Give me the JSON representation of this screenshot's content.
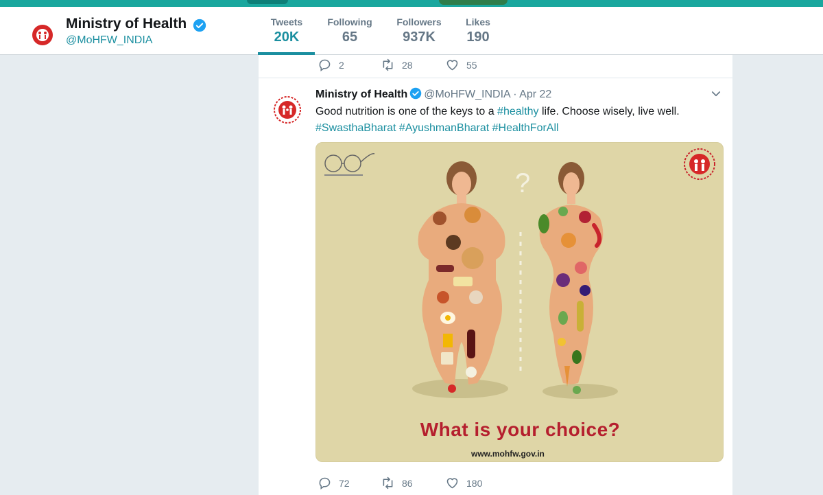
{
  "profile": {
    "name": "Ministry of Health",
    "handle": "@MoHFW_INDIA"
  },
  "stats": [
    {
      "label": "Tweets",
      "value": "20K",
      "active": true
    },
    {
      "label": "Following",
      "value": "65",
      "active": false
    },
    {
      "label": "Followers",
      "value": "937K",
      "active": false
    },
    {
      "label": "Likes",
      "value": "190",
      "active": false
    }
  ],
  "prev_tweet_actions": {
    "replies": "2",
    "retweets": "28",
    "likes": "55"
  },
  "tweet": {
    "name": "Ministry of Health",
    "handle_date": "@MoHFW_INDIA · Apr 22",
    "text_pre": "Good nutrition is one of the keys to a ",
    "text_tag": "#healthy",
    "text_post": " life. Choose wisely, live well.",
    "hashtags": "#SwasthaBharat #AyushmanBharat #HealthForAll",
    "media": {
      "question": "What is your choice?",
      "url": "www.mohfw.gov.in"
    },
    "actions": {
      "replies": "72",
      "retweets": "86",
      "likes": "180"
    }
  },
  "colors": {
    "accent": "#1b8fa0",
    "banner": "#1aa79e",
    "media_bg": "#dfd6a7",
    "question": "#b51f2e"
  },
  "icons": [
    "verified-icon",
    "reply-icon",
    "retweet-icon",
    "like-icon",
    "chevron-down-icon",
    "nhm-logo-icon",
    "swachh-bharat-logo"
  ]
}
